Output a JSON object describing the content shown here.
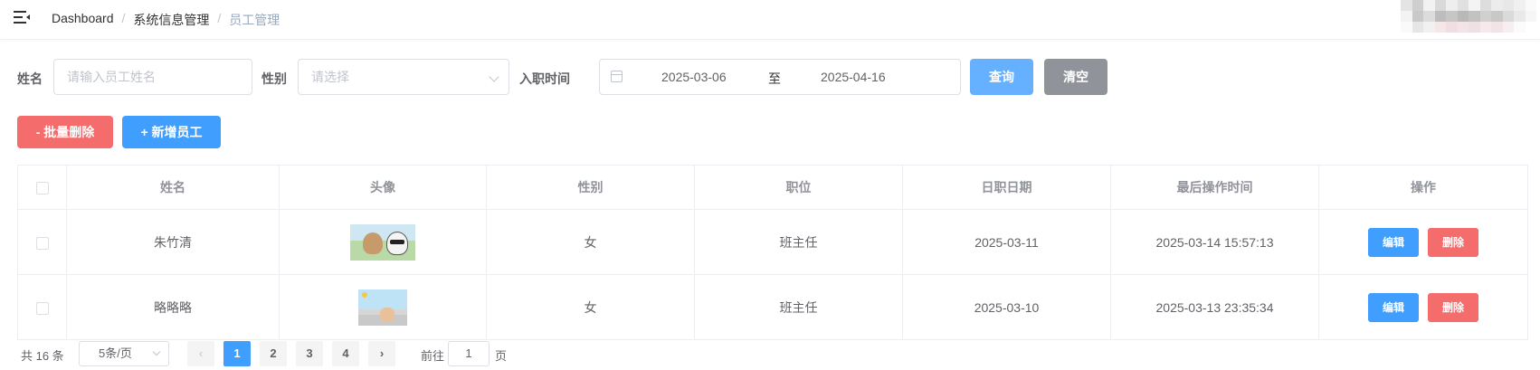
{
  "breadcrumb": [
    "Dashboard",
    "系统信息管理",
    "员工管理"
  ],
  "filter": {
    "name_label": "姓名",
    "name_placeholder": "请输入员工姓名",
    "gender_label": "性别",
    "gender_placeholder": "请选择",
    "hire_label": "入职时间",
    "date_start": "2025-03-06",
    "date_sep": "至",
    "date_end": "2025-04-16",
    "search_label": "查询",
    "clear_label": "清空"
  },
  "actions": {
    "batch_delete_label": "- 批量删除",
    "add_label": "+ 新增员工"
  },
  "table": {
    "headers": [
      "姓名",
      "头像",
      "性别",
      "职位",
      "日职日期",
      "最后操作时间",
      "操作"
    ],
    "rows": [
      {
        "name": "朱竹清",
        "gender": "女",
        "position": "班主任",
        "entry_date": "2025-03-11",
        "updated": "2025-03-14 15:57:13"
      },
      {
        "name": "略略略",
        "gender": "女",
        "position": "班主任",
        "entry_date": "2025-03-10",
        "updated": "2025-03-13 23:35:34"
      }
    ],
    "edit_label": "编辑",
    "delete_label": "删除"
  },
  "pagination": {
    "total_text": "共 16 条",
    "page_size": "5条/页",
    "pages": [
      "1",
      "2",
      "3",
      "4"
    ],
    "current_page": "1",
    "goto_label": "前往",
    "goto_value": "1",
    "page_suffix": "页"
  },
  "colors": {
    "primary": "#409eff",
    "primary_light": "#66b1ff",
    "danger": "#f56c6c",
    "info": "#909399"
  }
}
